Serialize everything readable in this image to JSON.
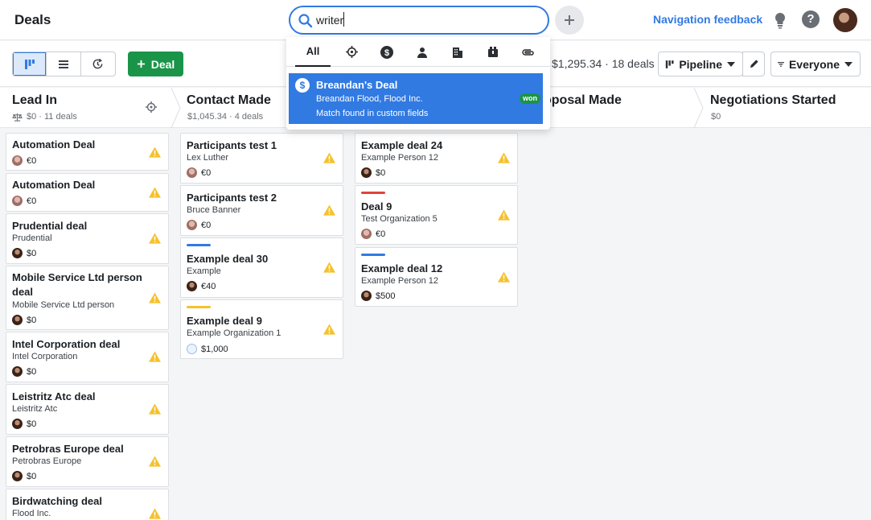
{
  "header": {
    "title": "Deals",
    "search_value": "writer",
    "nav_feedback": "Navigation feedback"
  },
  "toolbar": {
    "add_deal_label": "Deal",
    "summary": "$1,295.34 · 18 deals",
    "pipeline_label": "Pipeline",
    "filter_label": "Everyone"
  },
  "search_dropdown": {
    "tabs": [
      {
        "label": "All",
        "icon": "all"
      },
      {
        "icon": "target-icon"
      },
      {
        "icon": "dollar-icon"
      },
      {
        "icon": "person-icon"
      },
      {
        "icon": "building-icon"
      },
      {
        "icon": "product-box-icon"
      },
      {
        "icon": "paperclip-icon"
      }
    ],
    "result": {
      "title": "Breandan's Deal",
      "subtitle": "Breandan Flood, Flood Inc.",
      "match": "Match found in custom fields",
      "badge": "won"
    }
  },
  "stages": [
    {
      "name": "Lead In",
      "summary": "$0 · 11 deals"
    },
    {
      "name": "Contact Made",
      "summary": "$1,045.34 · 4 deals"
    },
    {
      "name": "oposal Made",
      "summary": ""
    },
    {
      "name": "Negotiations Started",
      "summary": "$0"
    }
  ],
  "columns": {
    "lead_in": [
      {
        "title": "Automation Deal",
        "value": "€0"
      },
      {
        "title": "Automation Deal",
        "value": "€0"
      },
      {
        "title": "Prudential deal",
        "subtitle": "Prudential",
        "value": "$0"
      },
      {
        "title_line1": "Mobile Service Ltd person",
        "title_line2": "deal",
        "subtitle": "Mobile Service Ltd person",
        "value": "$0"
      },
      {
        "title": "Intel Corporation deal",
        "subtitle": "Intel Corporation",
        "value": "$0"
      },
      {
        "title": "Leistritz Atc deal",
        "subtitle": "Leistritz Atc",
        "value": "$0"
      },
      {
        "title": "Petrobras Europe deal",
        "subtitle": "Petrobras Europe",
        "value": "$0"
      },
      {
        "title": "Birdwatching deal",
        "subtitle": "Flood Inc."
      }
    ],
    "contact_made": [
      {
        "title": "Participants test 1",
        "subtitle": "Lex Luther",
        "value": "€0"
      },
      {
        "title": "Participants test 2",
        "subtitle": "Bruce Banner",
        "value": "€0"
      },
      {
        "title": "Example deal 30",
        "subtitle": "Example",
        "value": "€40",
        "bar_color": "#317ae2"
      },
      {
        "title": "Example deal 9",
        "subtitle": "Example Organization 1",
        "value": "$1,000",
        "bar_color": "#f6c12b"
      }
    ],
    "proposal_made": [
      {
        "title": "Example deal 24",
        "subtitle": "Example Person 12",
        "value": "$0"
      },
      {
        "title": "Deal 9",
        "subtitle": "Test Organization 5",
        "value": "€0",
        "bar_color": "#e0433c"
      },
      {
        "title": "Example deal 12",
        "subtitle": "Example Person 12",
        "value": "$500",
        "bar_color": "#317ae2"
      }
    ]
  },
  "colors": {
    "accent": "#317ae2",
    "green": "#1a9448",
    "warning": "#f6c12b"
  }
}
